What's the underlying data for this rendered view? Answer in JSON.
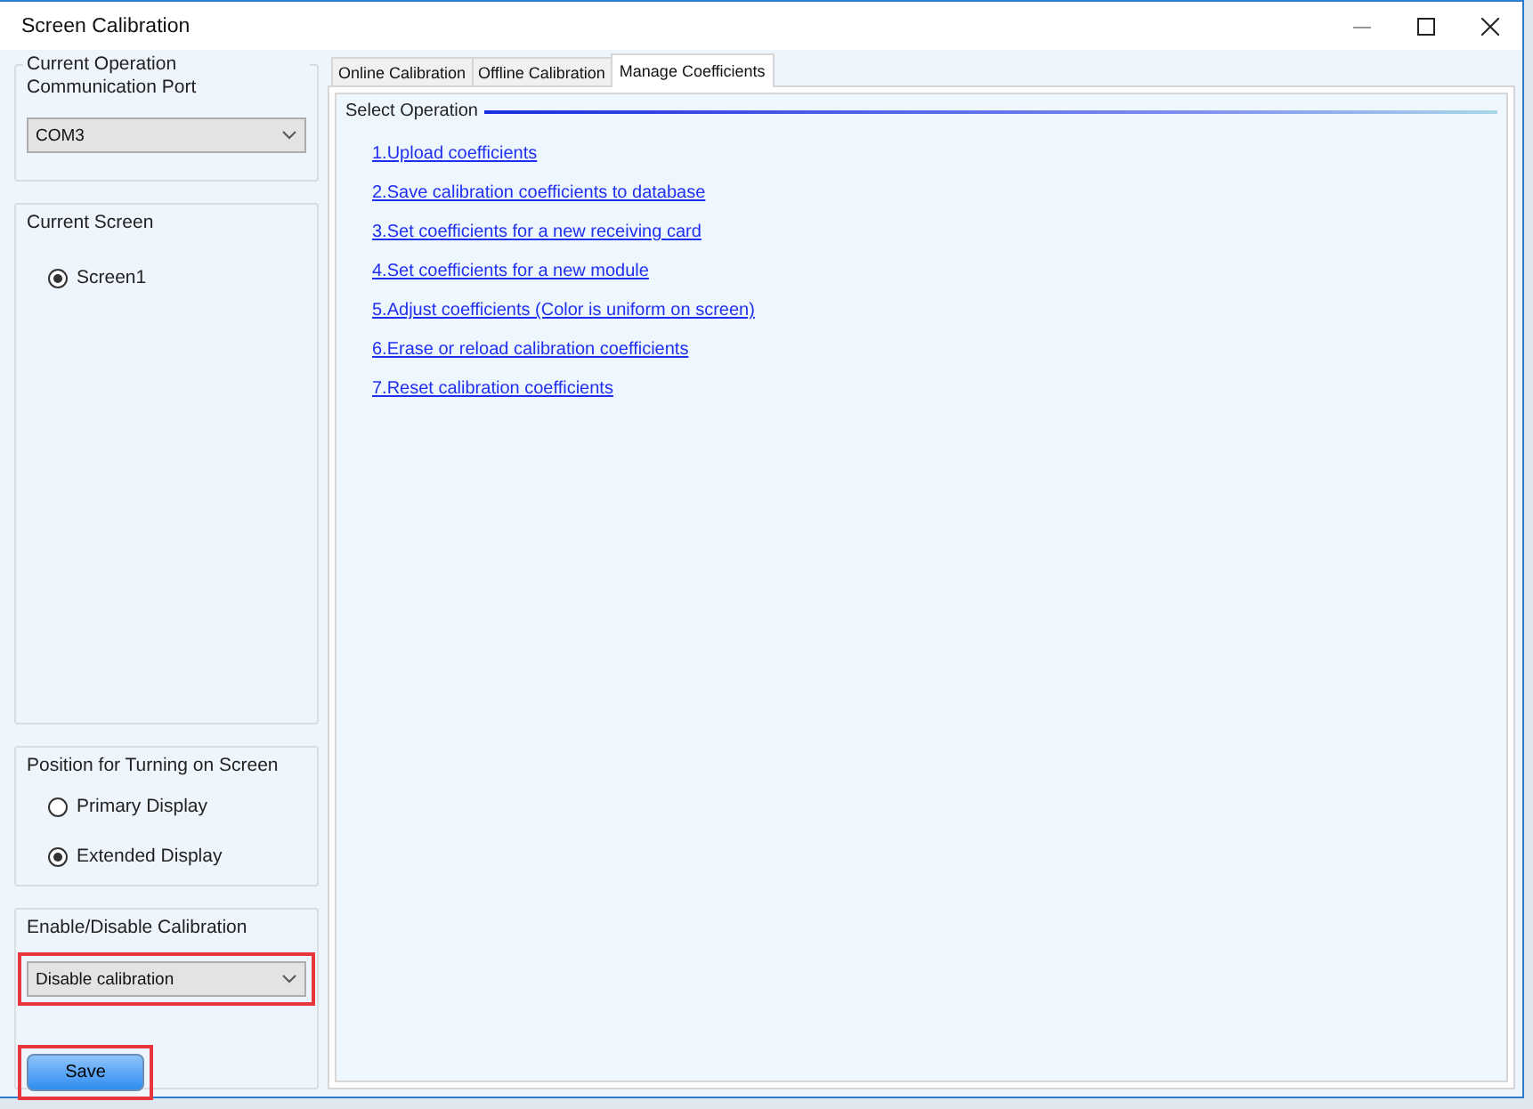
{
  "window": {
    "title": "Screen Calibration"
  },
  "left_panel": {
    "port_group": {
      "title": "Current Operation Communication Port",
      "dropdown": {
        "value": "COM3",
        "highlighted": false
      }
    },
    "screen_group": {
      "title": "Current Screen",
      "options": [
        {
          "label": "Screen1",
          "selected": true
        }
      ]
    },
    "position_group": {
      "title": "Position for Turning on Screen",
      "options": [
        {
          "label": "Primary Display",
          "selected": false
        },
        {
          "label": "Extended Display",
          "selected": true
        }
      ]
    },
    "calibration_group": {
      "title": "Enable/Disable Calibration",
      "dropdown": {
        "value": "Disable calibration",
        "highlighted": true
      },
      "save_button": {
        "label": "Save",
        "highlighted": true
      }
    }
  },
  "tabs": [
    {
      "label": "Online Calibration",
      "selected": false
    },
    {
      "label": "Offline Calibration",
      "selected": false
    },
    {
      "label": "Manage Coefficients",
      "selected": true
    }
  ],
  "operations": {
    "title": "Select Operation",
    "links": [
      "1.Upload coefficients",
      "2.Save calibration coefficients to database",
      "3.Set coefficients for a new receiving card",
      "4.Set coefficients for a new module",
      "5.Adjust coefficients (Color is uniform on screen)",
      "6.Erase or reload calibration coefficients",
      "7.Reset calibration coefficients"
    ]
  }
}
